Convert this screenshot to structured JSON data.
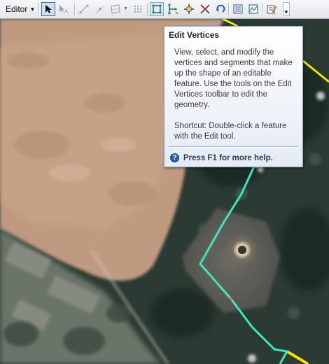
{
  "toolbar": {
    "editor_label": "Editor",
    "buttons": [
      {
        "name": "edit-tool-icon",
        "state": "pressed"
      },
      {
        "name": "edit-annotation-tool-icon",
        "state": "disabled"
      },
      {
        "name": "straight-segment-icon",
        "state": "disabled"
      },
      {
        "name": "construction-point-icon",
        "state": "disabled"
      },
      {
        "name": "cut-polygons-icon",
        "state": "disabled"
      },
      {
        "name": "edit-vertices-icon",
        "state": "hover"
      },
      {
        "name": "reshape-feature-icon",
        "state": "enabled"
      },
      {
        "name": "split-tool-icon",
        "state": "enabled"
      },
      {
        "name": "rotate-tool-icon",
        "state": "enabled"
      },
      {
        "name": "attributes-icon",
        "state": "enabled"
      },
      {
        "name": "sketch-properties-icon",
        "state": "enabled"
      },
      {
        "name": "create-features-icon",
        "state": "enabled"
      }
    ]
  },
  "tooltip": {
    "title": "Edit Vertices",
    "body": "View, select, and modify the vertices and segments that make up the shape of an editable feature. Use the tools on the Edit Vertices toolbar to edit the geometry.",
    "shortcut": "Shortcut: Double-click a feature with the Edit tool.",
    "help": "Press F1 for more help."
  },
  "colors": {
    "selected_outline": "#3ee6c0",
    "feature_outline": "#f2e600",
    "tooltip_border": "#8fa2bd"
  }
}
